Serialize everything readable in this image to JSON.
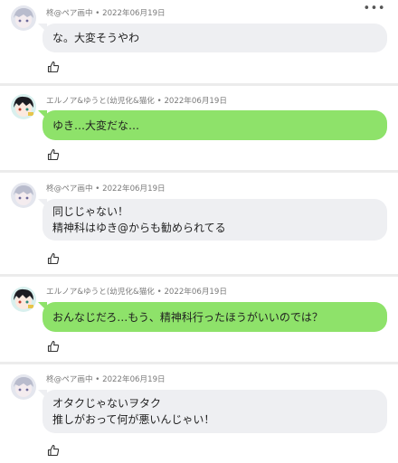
{
  "posts": [
    {
      "author": "柊@ペア画中",
      "date": "2022年06月19日",
      "avatar": "gray-hair-avatar",
      "bubble_color": "#eeeff2",
      "lines": [
        "な。大変そうやわ"
      ]
    },
    {
      "author": "エルノア&ゆうと(幼児化&猫化",
      "date": "2022年06月19日",
      "avatar": "dark-hair-avatar",
      "bubble_color": "#8ee26a",
      "lines": [
        "ゆき…大変だな…"
      ]
    },
    {
      "author": "柊@ペア画中",
      "date": "2022年06月19日",
      "avatar": "gray-hair-avatar",
      "bubble_color": "#eeeff2",
      "lines": [
        "同じじゃない！",
        "精神科はゆき@からも勧められてる"
      ]
    },
    {
      "author": "エルノア&ゆうと(幼児化&猫化",
      "date": "2022年06月19日",
      "avatar": "dark-hair-avatar",
      "bubble_color": "#8ee26a",
      "lines": [
        "おんなじだろ…もう、精神科行ったほうがいいのでは？"
      ]
    },
    {
      "author": "柊@ペア画中",
      "date": "2022年06月19日",
      "avatar": "gray-hair-avatar",
      "bubble_color": "#eeeff2",
      "lines": [
        "オタクじゃないヲタク",
        "推しがおって何が悪いんじゃい！"
      ]
    }
  ],
  "ui": {
    "meta_separator": " • ",
    "more_glyph": "•••",
    "like_icon": "thumbs-up-icon"
  }
}
